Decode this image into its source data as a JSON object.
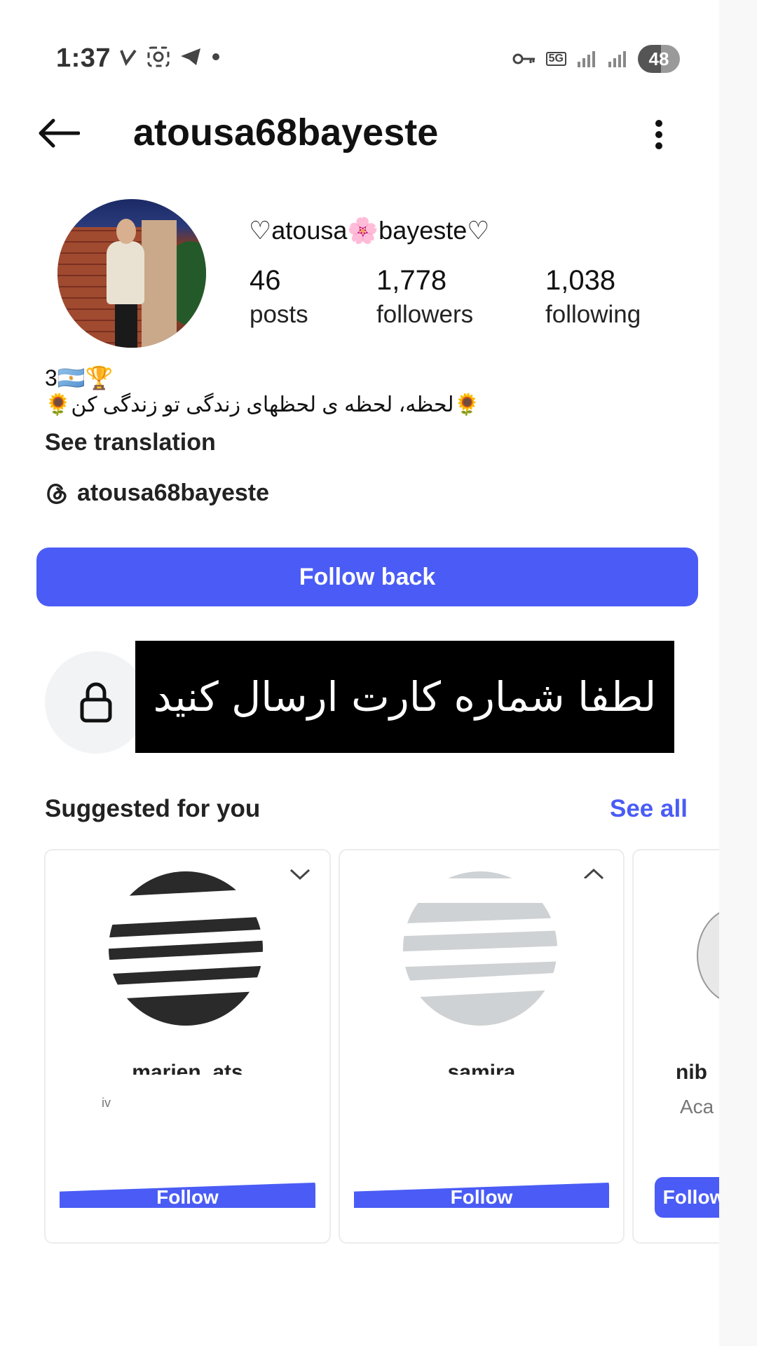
{
  "status_bar": {
    "time": "1:37",
    "network": "5G",
    "battery": "48"
  },
  "header": {
    "username": "atousa68bayeste"
  },
  "profile": {
    "display_name": "♡atousa🌸bayeste♡",
    "stats": [
      {
        "value": "46",
        "label": "posts"
      },
      {
        "value": "1,778",
        "label": "followers"
      },
      {
        "value": "1,038",
        "label": "following"
      }
    ],
    "bio_line1": "3🇦🇷🏆",
    "bio_line2": "🌻لحظه، لحظه ی لحظهای زندگی تو زندگی کن🌻",
    "see_translation": "See translation",
    "threads_handle": "atousa68bayeste"
  },
  "actions": {
    "follow_back": "Follow back"
  },
  "private_notice": {
    "overlay_text": "لطفا شماره کارت ارسال کنید"
  },
  "suggested": {
    "title": "Suggested for you",
    "see_all": "See all",
    "cards": [
      {
        "name": "marien_ats",
        "subtitle": "iv",
        "button": "Follow"
      },
      {
        "name": "samira",
        "subtitle": "",
        "button": "Follow"
      },
      {
        "name": "nib",
        "subtitle": "Aca",
        "button": "Follow"
      }
    ]
  },
  "colors": {
    "accent": "#4a5cf5",
    "banner_bg": "#000000"
  }
}
